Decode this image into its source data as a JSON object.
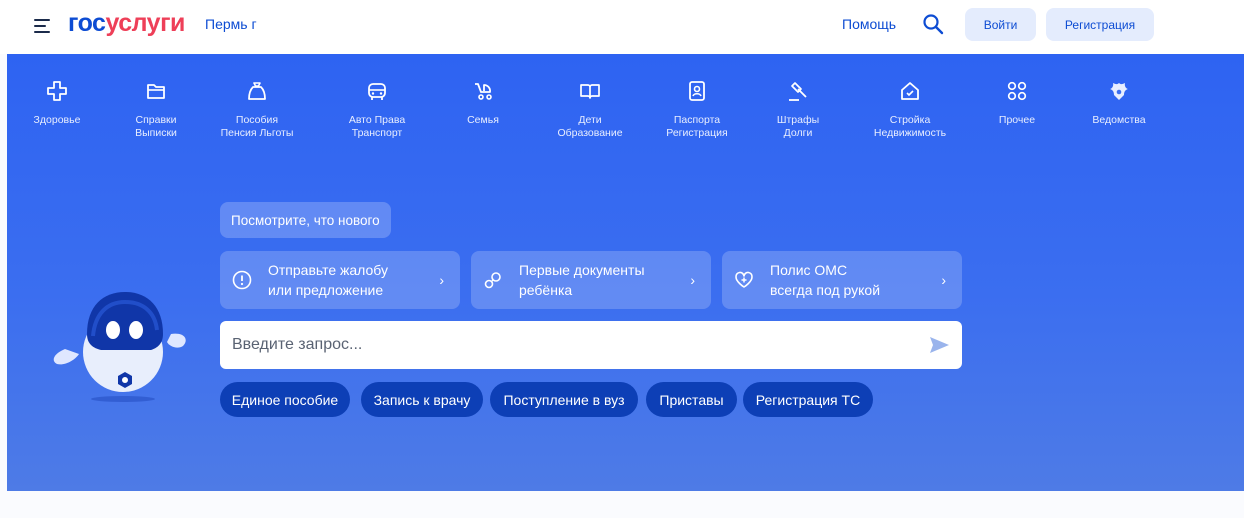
{
  "header": {
    "logo_part1": "гос",
    "logo_part2": "услуги",
    "city": "Пермь г",
    "help": "Помощь",
    "login": "Войти",
    "register": "Регистрация"
  },
  "categories": [
    {
      "line1": "Здоровье",
      "line2": "",
      "icon": "health-cross-icon"
    },
    {
      "line1": "Справки",
      "line2": "Выписки",
      "icon": "folder-icon"
    },
    {
      "line1": "Пособия",
      "line2": "Пенсия Льготы",
      "icon": "money-bag-icon"
    },
    {
      "line1": "Авто Права",
      "line2": "Транспорт",
      "icon": "car-icon"
    },
    {
      "line1": "Семья",
      "line2": "",
      "icon": "stroller-icon"
    },
    {
      "line1": "Дети",
      "line2": "Образование",
      "icon": "book-icon"
    },
    {
      "line1": "Паспорта",
      "line2": "Регистрация",
      "icon": "passport-icon"
    },
    {
      "line1": "Штрафы",
      "line2": "Долги",
      "icon": "gavel-icon"
    },
    {
      "line1": "Стройка",
      "line2": "Недвижимость",
      "icon": "house-icon"
    },
    {
      "line1": "Прочее",
      "line2": "",
      "icon": "grid-icon"
    },
    {
      "line1": "Ведомства",
      "line2": "",
      "icon": "emblem-icon"
    }
  ],
  "news_button": "Посмотрите, что нового",
  "cards": [
    {
      "line1": "Отправьте жалобу",
      "line2": "или предложение",
      "icon": "exclamation-icon"
    },
    {
      "line1": "Первые документы",
      "line2": "ребёнка",
      "icon": "pacifier-icon"
    },
    {
      "line1": "Полис ОМС",
      "line2": "всегда под рукой",
      "icon": "heart-plus-icon"
    }
  ],
  "search": {
    "placeholder": "Введите запрос..."
  },
  "chips": [
    "Единое пособие",
    "Запись к врачу",
    "Поступление в вуз",
    "Приставы",
    "Регистрация ТС"
  ],
  "colors": {
    "brand_blue": "#0d4cd3",
    "brand_red": "#ee3f58",
    "hero_blue": "#3b6ef0",
    "chip_blue": "#0d3fb6"
  }
}
